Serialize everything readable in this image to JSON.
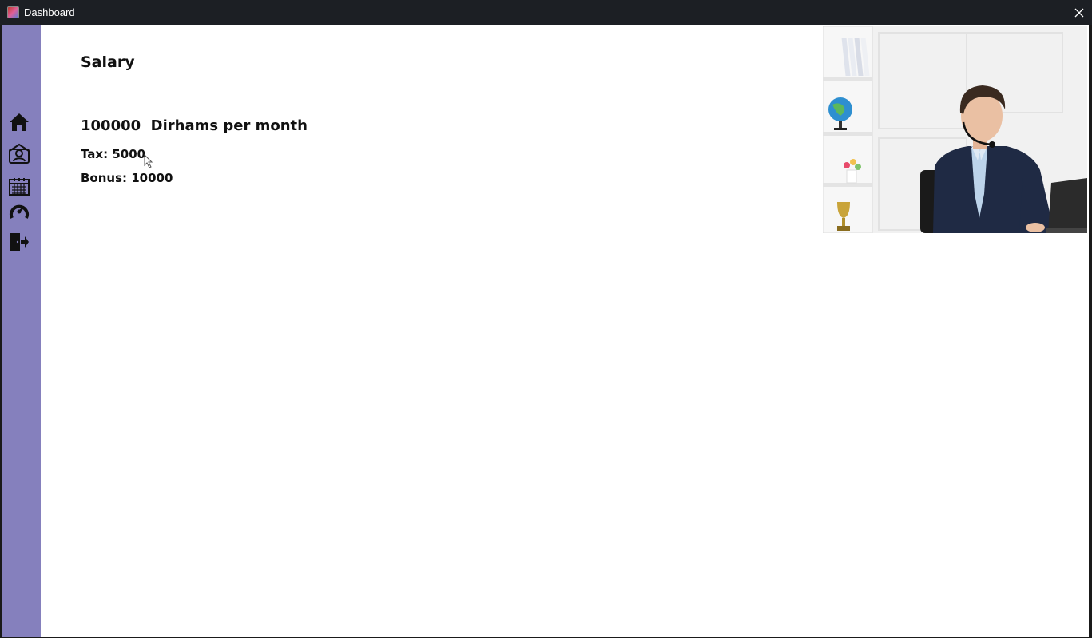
{
  "window": {
    "title": "Dashboard",
    "app_icon": "app-icon",
    "close_icon": "close-icon"
  },
  "sidebar": {
    "background": "#8580bd",
    "items": [
      {
        "icon": "home-icon"
      },
      {
        "icon": "id-badge-icon"
      },
      {
        "icon": "calendar-icon"
      },
      {
        "icon": "gauge-icon"
      },
      {
        "icon": "logout-icon"
      }
    ]
  },
  "main": {
    "title": "Salary",
    "salary_line": "100000  Dirhams per month",
    "tax_line": "Tax: 5000",
    "bonus_line": "Bonus: 10000"
  },
  "photo": {
    "description_icon": "photo-image"
  }
}
